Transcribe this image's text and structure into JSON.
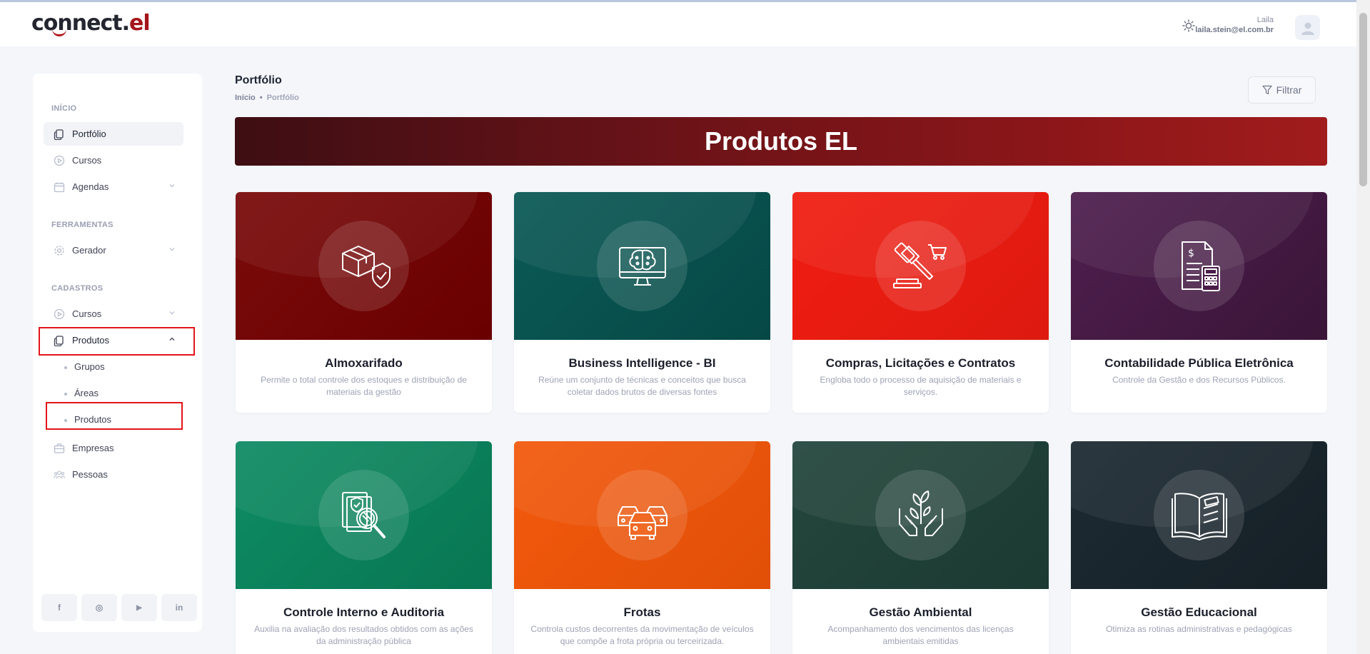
{
  "header": {
    "logo_main": "connect.",
    "logo_accent": "el",
    "user_name": "Laila",
    "user_email": "laila.stein@el.com.br",
    "theme_icon": "sun-icon",
    "avatar_icon": "user-avatar-icon"
  },
  "sidebar": {
    "sections": [
      {
        "title": "INÍCIO"
      },
      {
        "title": "FERRAMENTAS"
      },
      {
        "title": "CADASTROS"
      }
    ],
    "items": [
      {
        "label": "Portfólio",
        "icon": "files-icon"
      },
      {
        "label": "Cursos",
        "icon": "play-circle-icon"
      },
      {
        "label": "Agendas",
        "icon": "calendar-icon"
      },
      {
        "label": "Gerador",
        "icon": "gear-icon"
      },
      {
        "label": "Cursos",
        "icon": "play-circle-icon"
      },
      {
        "label": "Produtos",
        "icon": "files-icon"
      },
      {
        "label": "Empresas",
        "icon": "briefcase-icon"
      },
      {
        "label": "Pessoas",
        "icon": "users-icon"
      }
    ],
    "subitems": [
      {
        "label": "Grupos"
      },
      {
        "label": "Áreas"
      },
      {
        "label": "Produtos"
      }
    ],
    "social": [
      {
        "label": "f",
        "icon": "facebook-icon"
      },
      {
        "label": "◎",
        "icon": "instagram-icon"
      },
      {
        "label": "▶",
        "icon": "youtube-icon"
      },
      {
        "label": "in",
        "icon": "linkedin-icon"
      }
    ]
  },
  "page": {
    "title": "Portfólio",
    "breadcrumb": [
      "Início",
      "Portfólio"
    ],
    "filter_label": "Filtrar",
    "banner": "Produtos EL"
  },
  "products": [
    {
      "title": "Almoxarifado",
      "desc": "Permite o total controle dos estoques e distribuição de materiais da gestão",
      "color": "#7a0b0b",
      "color2": "#6a0000",
      "icon": "box-shield-icon"
    },
    {
      "title": "Business Intelligence - BI",
      "desc": "Reúne um conjunto de técnicas e conceitos que busca coletar dados brutos de diversas fontes",
      "color": "#0b5a57",
      "color2": "#064845",
      "icon": "brain-monitor-icon"
    },
    {
      "title": "Compras, Licitações e Contratos",
      "desc": "Engloba todo o processo de aquisição de materiais e serviços.",
      "color": "#f11d12",
      "color2": "#dd1a10",
      "icon": "gavel-cart-icon"
    },
    {
      "title": "Contabilidade Pública Eletrônica",
      "desc": "Controle da Gestão e dos Recursos Públicos.",
      "color": "#4f1f4f",
      "color2": "#3a1538",
      "icon": "invoice-calculator-icon"
    },
    {
      "title": "Controle Interno e Auditoria",
      "desc": "Auxilia na avaliação dos resultados obtidos com as ações da administração pública",
      "color": "#0e8c63",
      "color2": "#087652",
      "icon": "document-magnifier-icon"
    },
    {
      "title": "Frotas",
      "desc": "Controla custos decorrentes da movimentação de veículos que compõe a frota própria ou terceirizada.",
      "color": "#f35a0d",
      "color2": "#e14f08",
      "icon": "cars-icon"
    },
    {
      "title": "Gestão Ambiental",
      "desc": "Acompanhamento dos vencimentos das licenças ambientais emitidas",
      "color": "#24473d",
      "color2": "#1b3a32",
      "icon": "hands-plant-icon"
    },
    {
      "title": "Gestão Educacional",
      "desc": "Otimiza as rotinas administrativas e pedagógicas",
      "color": "#1d2b33",
      "color2": "#151f26",
      "icon": "open-book-icon"
    }
  ]
}
